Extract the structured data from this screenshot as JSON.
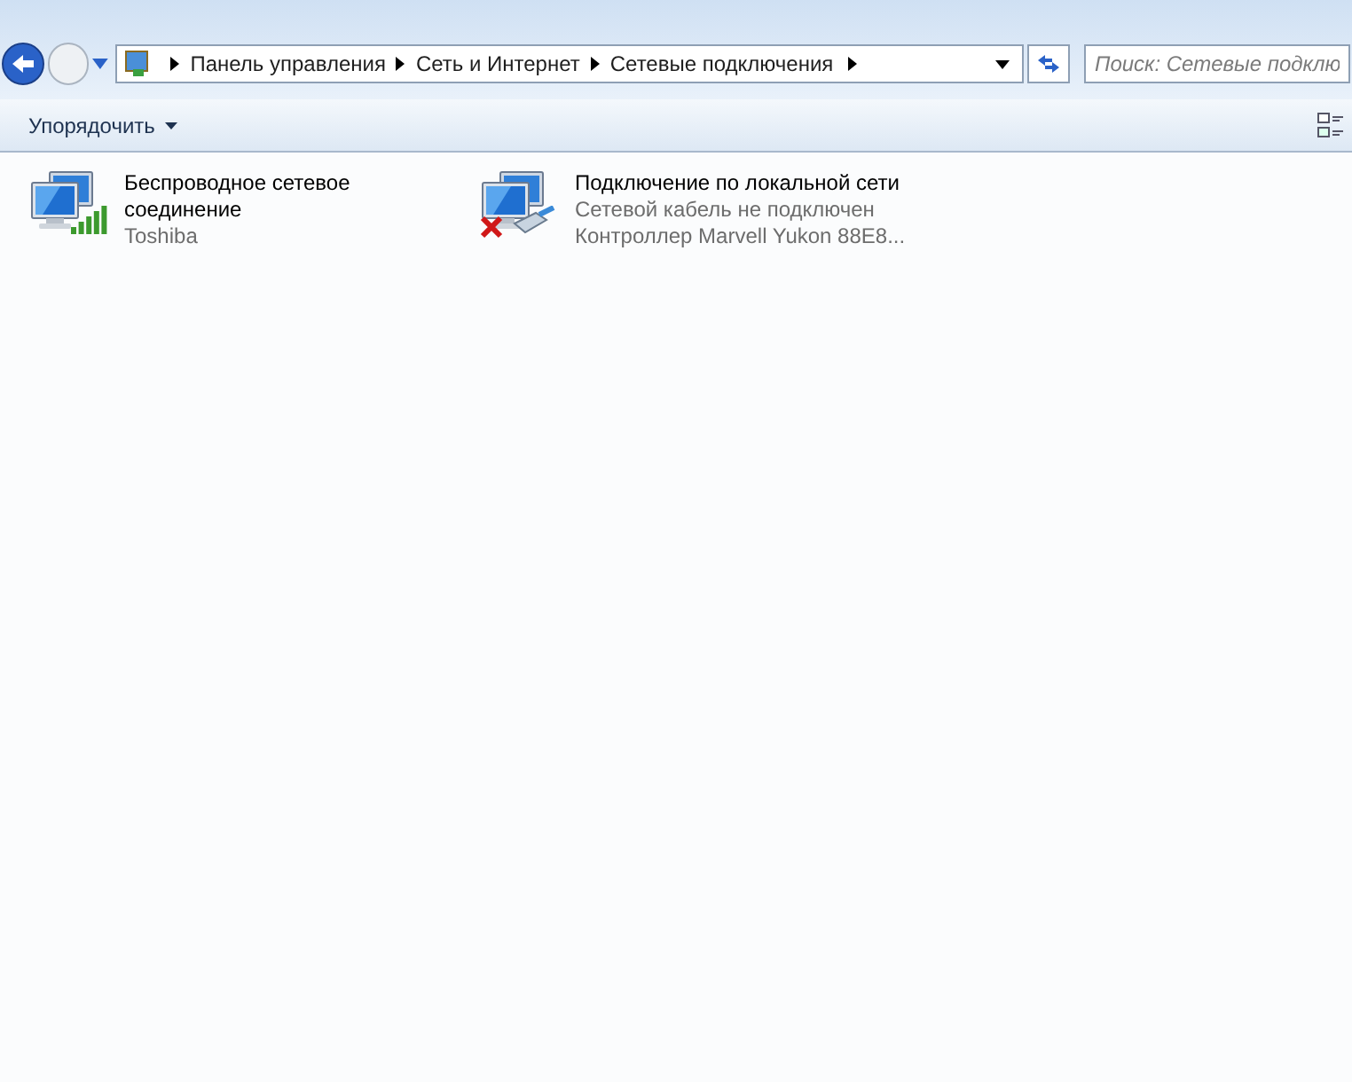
{
  "address_bar": {
    "segments": [
      "Панель управления",
      "Сеть и Интернет",
      "Сетевые подключения"
    ]
  },
  "search": {
    "placeholder": "Поиск: Сетевые подклю"
  },
  "toolbar": {
    "organize": "Упорядочить"
  },
  "connections": [
    {
      "kind": "wireless",
      "name": "Беспроводное сетевое соединение",
      "lines": [
        "Toshiba"
      ]
    },
    {
      "kind": "wired",
      "name": "Подключение по локальной сети",
      "lines": [
        "Сетевой кабель не подключен",
        "Контроллер Marvell Yukon 88E8..."
      ]
    }
  ]
}
